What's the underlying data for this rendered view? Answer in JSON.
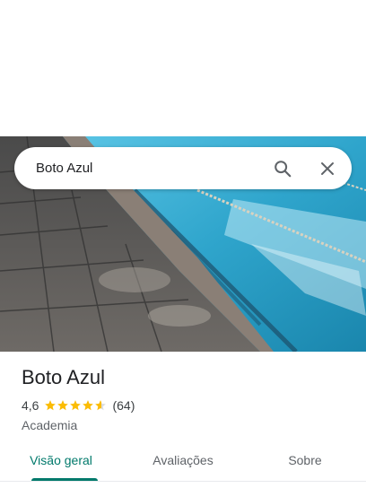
{
  "search": {
    "value": "Boto Azul",
    "placeholder": ""
  },
  "place": {
    "name": "Boto Azul",
    "rating": "4,6",
    "stars": 4.6,
    "review_count": "(64)",
    "category": "Academia"
  },
  "tabs": [
    {
      "label": "Visão geral",
      "active": true
    },
    {
      "label": "Avaliações",
      "active": false
    },
    {
      "label": "Sobre",
      "active": false
    }
  ],
  "colors": {
    "accent": "#00796b",
    "star": "#fbbc04",
    "pool": "#2ea3c9"
  },
  "icons": [
    "search-icon",
    "close-icon",
    "star-icon"
  ]
}
